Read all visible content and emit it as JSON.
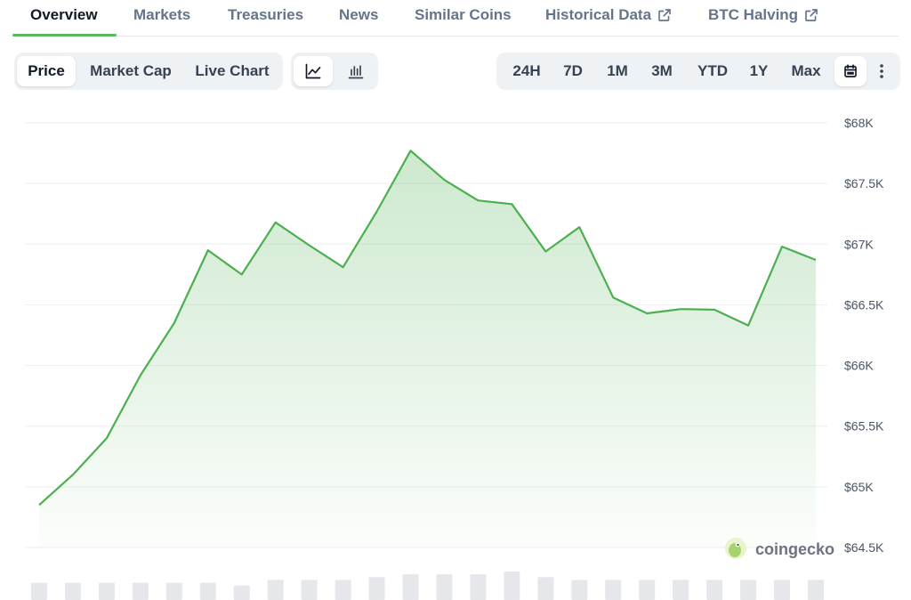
{
  "nav": {
    "tabs": [
      {
        "label": "Overview",
        "active": true,
        "external": false
      },
      {
        "label": "Markets",
        "active": false,
        "external": false
      },
      {
        "label": "Treasuries",
        "active": false,
        "external": false
      },
      {
        "label": "News",
        "active": false,
        "external": false
      },
      {
        "label": "Similar Coins",
        "active": false,
        "external": false
      },
      {
        "label": "Historical Data",
        "active": false,
        "external": true
      },
      {
        "label": "BTC Halving",
        "active": false,
        "external": true
      }
    ]
  },
  "metric_toggle": {
    "options": [
      "Price",
      "Market Cap",
      "Live Chart"
    ],
    "selected": "Price"
  },
  "chart_style_toggle": {
    "options": [
      "line-chart-icon",
      "candlestick-chart-icon"
    ],
    "selected": "line-chart-icon"
  },
  "range_toggle": {
    "options": [
      "24H",
      "7D",
      "1M",
      "3M",
      "YTD",
      "1Y",
      "Max"
    ],
    "selected": "calendar-icon",
    "extra_icons": [
      "calendar-icon",
      "more-vertical-icon"
    ]
  },
  "watermark": {
    "text": "coingecko"
  },
  "colors": {
    "line": "#4caf50",
    "fill_top": "#c8e6c9",
    "accent_tab": "#5cb85c",
    "grid": "#eeeeee",
    "volume": "#e5e7eb"
  },
  "chart_data": {
    "type": "area",
    "x": [
      0,
      1,
      2,
      3,
      4,
      5,
      6,
      7,
      8,
      9,
      10,
      11,
      12,
      13,
      14,
      15,
      16,
      17,
      18,
      19,
      20,
      21,
      22,
      23,
      24
    ],
    "y": [
      64850,
      65100,
      65400,
      65920,
      66350,
      66950,
      66750,
      67180,
      66990,
      66810,
      67270,
      67770,
      67530,
      67360,
      67330,
      66940,
      67140,
      66560,
      66430,
      66465,
      66460,
      66330,
      66980,
      66870
    ],
    "volume": [
      3,
      3,
      3,
      3,
      3,
      3,
      2,
      4,
      4,
      4,
      5,
      6,
      6,
      6,
      7,
      5,
      4,
      4,
      4,
      4,
      4,
      4,
      4,
      4
    ],
    "y_ticks": [
      "$68K",
      "$67.5K",
      "$67K",
      "$66.5K",
      "$66K",
      "$65.5K",
      "$65K",
      "$64.5K"
    ],
    "y_tick_values": [
      68000,
      67500,
      67000,
      66500,
      66000,
      65500,
      65000,
      64500
    ],
    "ylim": [
      64500,
      68000
    ],
    "grid": true
  }
}
